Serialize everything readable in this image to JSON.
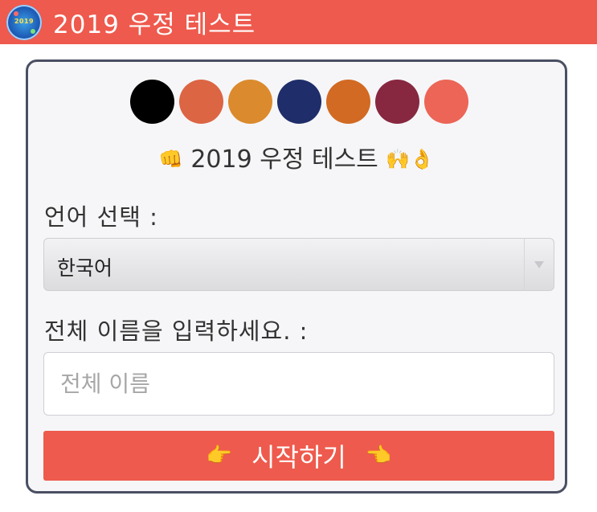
{
  "header": {
    "logo_text": "2019",
    "title": "2019 우정 테스트"
  },
  "swatches": [
    {
      "name": "black",
      "color": "#000000"
    },
    {
      "name": "terracotta",
      "color": "#dc6543"
    },
    {
      "name": "orange",
      "color": "#db8a2d"
    },
    {
      "name": "navy",
      "color": "#1f2d6a"
    },
    {
      "name": "burnt-orange",
      "color": "#d26a23"
    },
    {
      "name": "maroon",
      "color": "#872840"
    },
    {
      "name": "salmon",
      "color": "#ec6557"
    }
  ],
  "subtitle": {
    "prefix_emoji": "👊",
    "text": "2019 우정 테스트",
    "suffix_emoji": "🙌👌"
  },
  "language": {
    "label": "언어 선택 :",
    "selected": "한국어"
  },
  "name_field": {
    "label": "전체 이름을 입력하세요. :",
    "placeholder": "전체 이름",
    "value": ""
  },
  "start_button": {
    "left_emoji": "👉",
    "label": "시작하기",
    "right_emoji": "👈"
  },
  "colors": {
    "accent": "#ee5a4d",
    "card_border": "#4a4f62"
  }
}
